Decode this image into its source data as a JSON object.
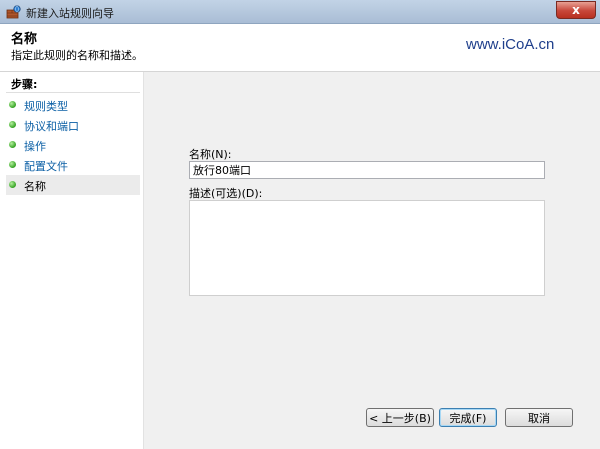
{
  "window": {
    "title": "新建入站规则向导",
    "close_glyph": "x"
  },
  "header": {
    "title": "名称",
    "subtitle": "指定此规则的名称和描述。",
    "watermark": "www.iCoA.cn"
  },
  "sidebar": {
    "heading": "步骤:",
    "items": [
      {
        "label": "规则类型"
      },
      {
        "label": "协议和端口"
      },
      {
        "label": "操作"
      },
      {
        "label": "配置文件"
      },
      {
        "label": "名称"
      }
    ]
  },
  "form": {
    "name_label": "名称(N):",
    "name_value": "放行80端口",
    "desc_label": "描述(可选)(D):",
    "desc_value": ""
  },
  "buttons": {
    "back": "< 上一步(B)",
    "finish": "完成(F)",
    "cancel": "取消"
  },
  "colors": {
    "accent": "#3c7fb1",
    "link": "#0b5fa5",
    "step_dot": "#3da82a",
    "close": "#c7473a"
  }
}
